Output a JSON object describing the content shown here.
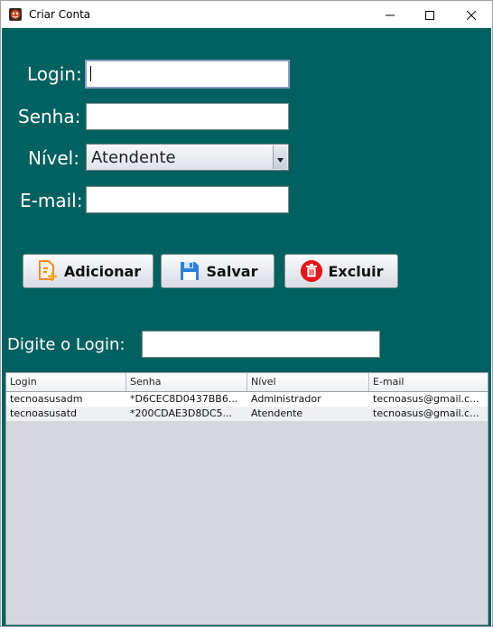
{
  "window": {
    "title": "Criar Conta",
    "app_icon": "app-icon",
    "controls": [
      "minimize-icon",
      "maximize-icon",
      "close-icon"
    ]
  },
  "form": {
    "login_label": "Login:",
    "login_value": "",
    "senha_label": "Senha:",
    "senha_value": "",
    "nivel_label": "Nível:",
    "nivel_selected": "Atendente",
    "email_label": "E-mail:",
    "email_value": ""
  },
  "buttons": {
    "adicionar": "Adicionar",
    "salvar": "Salvar",
    "excluir": "Excluir"
  },
  "search": {
    "label": "Digite o Login:",
    "value": ""
  },
  "table": {
    "columns": [
      "Login",
      "Senha",
      "Nível",
      "E-mail"
    ],
    "rows": [
      [
        "tecnoasusadm",
        "*D6CEC8D0437BB6...",
        "Administrador",
        "tecnoasus@gmail.c..."
      ],
      [
        "tecnoasusatd",
        "*200CDAE3D8DC5...",
        "Atendente",
        "tecnoasus@gmail.c..."
      ]
    ]
  },
  "colors": {
    "background": "#006160",
    "table_background": "#d4d7dc"
  }
}
